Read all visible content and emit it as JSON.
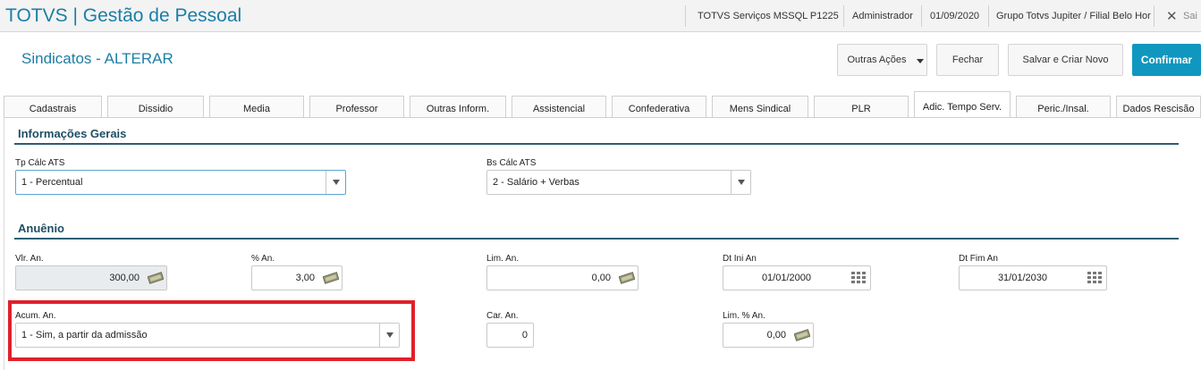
{
  "topbar": {
    "app_title": "TOTVS | Gestão de Pessoal",
    "environment": "TOTVS Serviços MSSQL P1225",
    "user": "Administrador",
    "date": "01/09/2020",
    "company": "Grupo Totvs Jupiter / Filial Belo Hor",
    "close_label": "Sai"
  },
  "header": {
    "title": "Sindicatos - ALTERAR",
    "buttons": {
      "other_actions": "Outras Ações",
      "close": "Fechar",
      "save_new": "Salvar e Criar Novo",
      "confirm": "Confirmar"
    }
  },
  "tabs": [
    {
      "label": "Cadastrais"
    },
    {
      "label": "Dissidio"
    },
    {
      "label": "Media"
    },
    {
      "label": "Professor"
    },
    {
      "label": "Outras Inform."
    },
    {
      "label": "Assistencial"
    },
    {
      "label": "Confederativa"
    },
    {
      "label": "Mens Sindical"
    },
    {
      "label": "PLR"
    },
    {
      "label": "Adic. Tempo Serv."
    },
    {
      "label": "Peric./Insal."
    },
    {
      "label": "Dados Rescisão"
    }
  ],
  "active_tab": "Adic. Tempo Serv.",
  "sections": {
    "general": {
      "title": "Informações Gerais",
      "tp_calc": {
        "label": "Tp Cálc ATS",
        "value": "1 - Percentual"
      },
      "bs_calc": {
        "label": "Bs Cálc ATS",
        "value": "2 - Salário + Verbas"
      }
    },
    "anuenio": {
      "title": "Anuênio",
      "vlr": {
        "label": "Vlr. An.",
        "value": "300,00"
      },
      "pct": {
        "label": "% An.",
        "value": "3,00"
      },
      "lim": {
        "label": "Lim. An.",
        "value": "0,00"
      },
      "dt_ini": {
        "label": "Dt Ini An",
        "value": "01/01/2000"
      },
      "dt_fim": {
        "label": "Dt Fim An",
        "value": "31/01/2030"
      },
      "acum": {
        "label": "Acum. An.",
        "value": "1 - Sim, a partir da admissão"
      },
      "car": {
        "label": "Car. An.",
        "value": "0"
      },
      "lim_pct": {
        "label": "Lim. % An.",
        "value": "0,00"
      }
    }
  },
  "colors": {
    "accent": "#1b7ea6",
    "confirm": "#0f97bf",
    "section": "#1e4e64",
    "highlight": "#e0202a"
  },
  "icons": [
    "money-icon",
    "calendar-icon",
    "dropdown-arrow-icon"
  ]
}
